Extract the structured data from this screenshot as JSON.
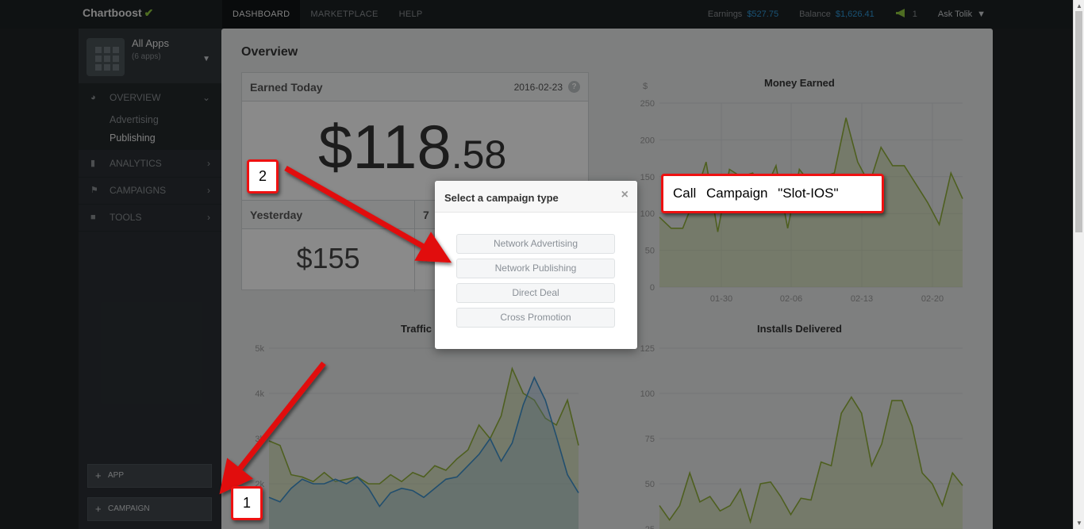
{
  "brand": {
    "name": "Chartboost",
    "leaf_icon": "leaf-icon"
  },
  "nav": [
    "DASHBOARD",
    "MARKETPLACE",
    "HELP"
  ],
  "topbar": {
    "earnings_label": "Earnings",
    "earnings_value": "$527.75",
    "balance_label": "Balance",
    "balance_value": "$1,626.41",
    "notifications_count": "1",
    "user_menu": "Ask Tolik"
  },
  "sidebar": {
    "app_selector": {
      "title": "All Apps",
      "subtitle": "(6 apps)"
    },
    "overview": {
      "label": "OVERVIEW",
      "items": [
        "Advertising",
        "Publishing"
      ],
      "active_item": "Publishing"
    },
    "sections": [
      "ANALYTICS",
      "CAMPAIGNS",
      "TOOLS"
    ],
    "add_app_label": "APP",
    "add_campaign_label": "CAMPAIGN"
  },
  "content": {
    "title": "Overview",
    "earned_today": {
      "label": "Earned Today",
      "date": "2016-02-23",
      "help": "?",
      "amount_main": "$118",
      "amount_cents": ".58"
    },
    "yesterday": {
      "label": "Yesterday",
      "value": "$155"
    },
    "seven_day": {
      "label": "7"
    }
  },
  "modal": {
    "title": "Select a campaign type",
    "close": "×",
    "options": [
      "Network Advertising",
      "Network Publishing",
      "Direct Deal",
      "Cross Promotion"
    ]
  },
  "annotations": {
    "callout": "Call Campaign \"Slot-IOS\"",
    "step_1": "1",
    "step_2": "2"
  },
  "colors": {
    "accent_blue": "#2e95d3",
    "accent_green": "#8ec63f",
    "annotation_red": "#e11111"
  },
  "chart_data": [
    {
      "type": "area",
      "title": "Money Earned",
      "ylabel": "$",
      "yticks": [
        "250",
        "200",
        "150",
        "100",
        "50",
        "0"
      ],
      "xticks": [
        "01-30",
        "02-06",
        "02-13",
        "02-20"
      ],
      "ylim": [
        0,
        250
      ],
      "series": [
        {
          "values": [
            95,
            80,
            80,
            120,
            170,
            75,
            160,
            150,
            155,
            130,
            165,
            80,
            160,
            140,
            150,
            155,
            230,
            170,
            140,
            190,
            165,
            165,
            140,
            115,
            85,
            155,
            120
          ]
        }
      ]
    },
    {
      "type": "area",
      "title": "Traffic",
      "yticks": [
        "5k",
        "4k",
        "3k",
        "2k"
      ],
      "ylim": [
        1000,
        5000
      ],
      "series": [
        {
          "values": [
            2950,
            2850,
            2200,
            2150,
            2050,
            2250,
            2050,
            2100,
            2150,
            2000,
            2000,
            2200,
            2050,
            2250,
            2150,
            2400,
            2300,
            2550,
            2750,
            3300,
            3000,
            3500,
            4550,
            4000,
            3850,
            3450,
            3300,
            3850,
            2850
          ]
        },
        {
          "values": [
            1700,
            1600,
            1900,
            2100,
            2000,
            2000,
            2100,
            2000,
            2150,
            1900,
            1500,
            1800,
            1900,
            1850,
            1700,
            1900,
            2100,
            2150,
            2400,
            2650,
            3000,
            2500,
            2900,
            3750,
            4350,
            3850,
            3050,
            2200,
            1800
          ]
        }
      ]
    },
    {
      "type": "area",
      "title": "Installs Delivered",
      "yticks": [
        "125",
        "100",
        "75",
        "50",
        "25"
      ],
      "ylim": [
        25,
        125
      ],
      "series": [
        {
          "values": [
            38,
            30,
            38,
            56,
            40,
            43,
            35,
            38,
            47,
            29,
            50,
            51,
            43,
            33,
            42,
            41,
            62,
            60,
            89,
            98,
            89,
            60,
            72,
            96,
            96,
            82,
            56,
            50,
            38,
            56,
            49
          ]
        }
      ]
    }
  ]
}
